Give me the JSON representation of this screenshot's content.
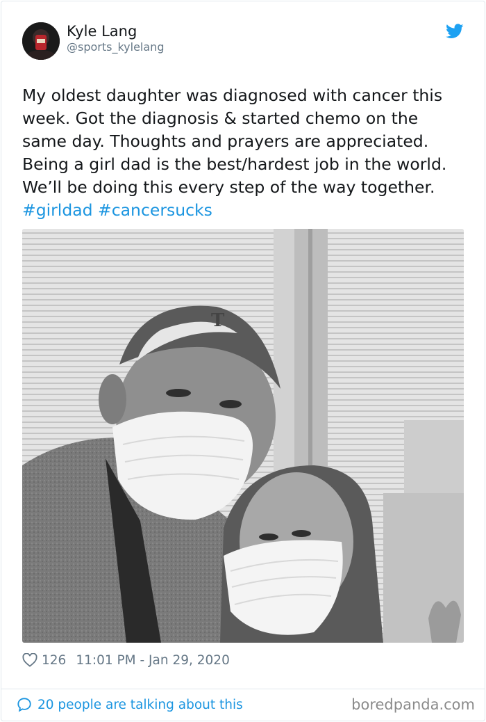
{
  "author": {
    "name": "Kyle Lang",
    "handle": "@sports_kylelang",
    "avatar_icon": "avatar-photo"
  },
  "platform_icon": "twitter-bird-icon",
  "tweet": {
    "lines": [
      "My oldest daughter was diagnosed with cancer this",
      "week. Got the diagnosis & started chemo on the",
      "same day. Thoughts and prayers are appreciated.",
      "Being a girl dad is the best/hardest job in the world.",
      "We’ll be doing this every step of the way together."
    ],
    "hashtags": [
      "#girldad",
      "#cancersucks"
    ]
  },
  "meta": {
    "likes": "126",
    "timestamp": "11:01 PM - Jan 29, 2020"
  },
  "footer": {
    "talking_label": "20 people are talking about this",
    "watermark": "boredpanda.com"
  },
  "colors": {
    "link": "#1b95e0",
    "secondary_text": "#657786",
    "border": "#e1e8ed"
  }
}
